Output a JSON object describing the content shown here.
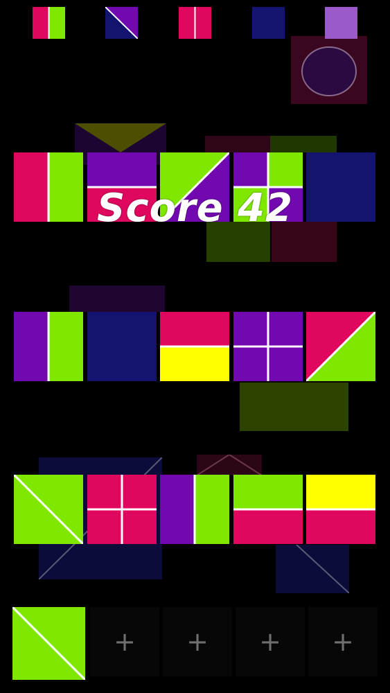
{
  "score": {
    "label": "Score 42"
  },
  "colors": {
    "background": "#000000",
    "pink": "#e0085e",
    "green": "#80e800",
    "purple": "#7209b0",
    "navy": "#141470",
    "yellow": "#ffff00",
    "lavender": "#9b59c9",
    "divider": "#ffffff"
  },
  "top_row": [
    {
      "id": "mini-1",
      "split": "vertical",
      "colors": [
        "pink",
        "green"
      ]
    },
    {
      "id": "mini-2",
      "split": "diag-tl-br",
      "colors": [
        "navy",
        "purple"
      ]
    },
    {
      "id": "mini-3",
      "split": "vertical",
      "colors": [
        "pink",
        "pink"
      ]
    },
    {
      "id": "mini-4",
      "split": "none",
      "colors": [
        "navy"
      ]
    },
    {
      "id": "mini-5",
      "split": "none",
      "colors": [
        "lavender"
      ]
    }
  ],
  "rows": [
    [
      {
        "split": "vertical",
        "colors": [
          "pink",
          "green"
        ]
      },
      {
        "split": "horizontal",
        "colors": [
          "purple",
          "pink"
        ]
      },
      {
        "split": "diag-bl-tr",
        "colors": [
          "green",
          "purple"
        ]
      },
      {
        "split": "quad",
        "colors": [
          "purple",
          "green",
          "green",
          "purple"
        ]
      },
      {
        "split": "none",
        "colors": [
          "navy"
        ]
      }
    ],
    [
      {
        "split": "vertical",
        "colors": [
          "purple",
          "green"
        ]
      },
      {
        "split": "none",
        "colors": [
          "navy"
        ]
      },
      {
        "split": "horizontal",
        "colors": [
          "pink",
          "yellow"
        ]
      },
      {
        "split": "quad",
        "colors": [
          "purple",
          "purple",
          "purple",
          "purple"
        ]
      },
      {
        "split": "diag-bl-tr",
        "colors": [
          "pink",
          "green"
        ]
      }
    ],
    [
      {
        "split": "diag-tl-br",
        "colors": [
          "green",
          "green"
        ]
      },
      {
        "split": "quad",
        "colors": [
          "pink",
          "pink",
          "pink",
          "pink"
        ]
      },
      {
        "split": "vertical",
        "colors": [
          "purple",
          "green"
        ]
      },
      {
        "split": "horizontal",
        "colors": [
          "green",
          "pink"
        ]
      },
      {
        "split": "horizontal",
        "colors": [
          "yellow",
          "pink"
        ]
      }
    ]
  ],
  "tray": {
    "current": {
      "split": "diag-tl-br",
      "colors": [
        "green",
        "green"
      ]
    },
    "empty_slots": [
      "+",
      "+",
      "+",
      "+"
    ]
  }
}
